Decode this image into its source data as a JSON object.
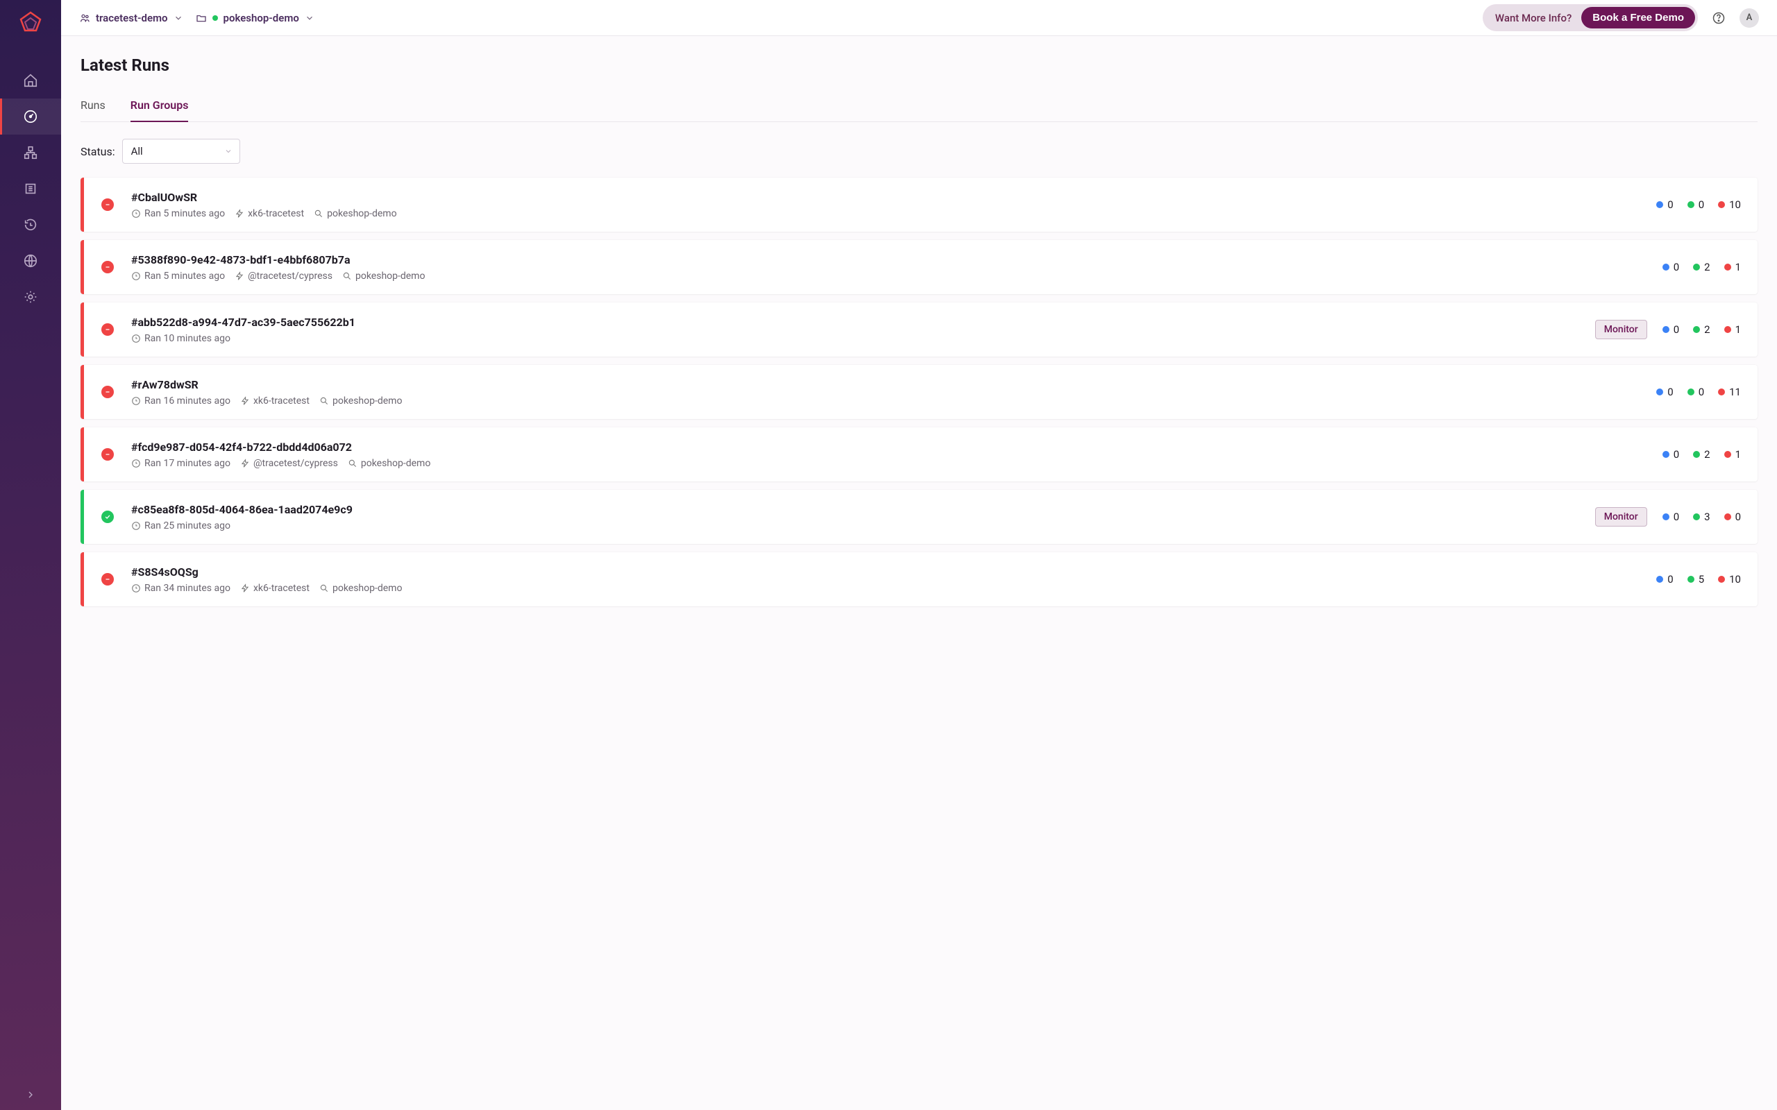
{
  "sidebar": {
    "footer_icon": "chevron-right"
  },
  "header": {
    "org": "tracetest-demo",
    "project": "pokeshop-demo",
    "more_info": "Want More Info?",
    "book_demo": "Book a Free Demo",
    "avatar_initial": "A"
  },
  "page": {
    "title": "Latest Runs",
    "tabs": [
      "Runs",
      "Run Groups"
    ],
    "active_tab": 1
  },
  "filter": {
    "label": "Status:",
    "value": "All"
  },
  "colors": {
    "accent": "#6c1656",
    "fail": "#ef4444",
    "pass": "#22c55e",
    "blue": "#3b82f6"
  },
  "runs": [
    {
      "id": "#CbalUOwSR",
      "status": "fail",
      "time": "Ran 5 minutes ago",
      "source": "xk6-tracetest",
      "env": "pokeshop-demo",
      "badge": null,
      "counts": {
        "blue": 0,
        "green": 0,
        "red": 10
      }
    },
    {
      "id": "#5388f890-9e42-4873-bdf1-e4bbf6807b7a",
      "status": "fail",
      "time": "Ran 5 minutes ago",
      "source": "@tracetest/cypress",
      "env": "pokeshop-demo",
      "badge": null,
      "counts": {
        "blue": 0,
        "green": 2,
        "red": 1
      }
    },
    {
      "id": "#abb522d8-a994-47d7-ac39-5aec755622b1",
      "status": "fail",
      "time": "Ran 10 minutes ago",
      "source": null,
      "env": null,
      "badge": "Monitor",
      "counts": {
        "blue": 0,
        "green": 2,
        "red": 1
      }
    },
    {
      "id": "#rAw78dwSR",
      "status": "fail",
      "time": "Ran 16 minutes ago",
      "source": "xk6-tracetest",
      "env": "pokeshop-demo",
      "badge": null,
      "counts": {
        "blue": 0,
        "green": 0,
        "red": 11
      }
    },
    {
      "id": "#fcd9e987-d054-42f4-b722-dbdd4d06a072",
      "status": "fail",
      "time": "Ran 17 minutes ago",
      "source": "@tracetest/cypress",
      "env": "pokeshop-demo",
      "badge": null,
      "counts": {
        "blue": 0,
        "green": 2,
        "red": 1
      }
    },
    {
      "id": "#c85ea8f8-805d-4064-86ea-1aad2074e9c9",
      "status": "pass",
      "time": "Ran 25 minutes ago",
      "source": null,
      "env": null,
      "badge": "Monitor",
      "counts": {
        "blue": 0,
        "green": 3,
        "red": 0
      }
    },
    {
      "id": "#S8S4sOQSg",
      "status": "fail",
      "time": "Ran 34 minutes ago",
      "source": "xk6-tracetest",
      "env": "pokeshop-demo",
      "badge": null,
      "counts": {
        "blue": 0,
        "green": 5,
        "red": 10
      }
    }
  ]
}
